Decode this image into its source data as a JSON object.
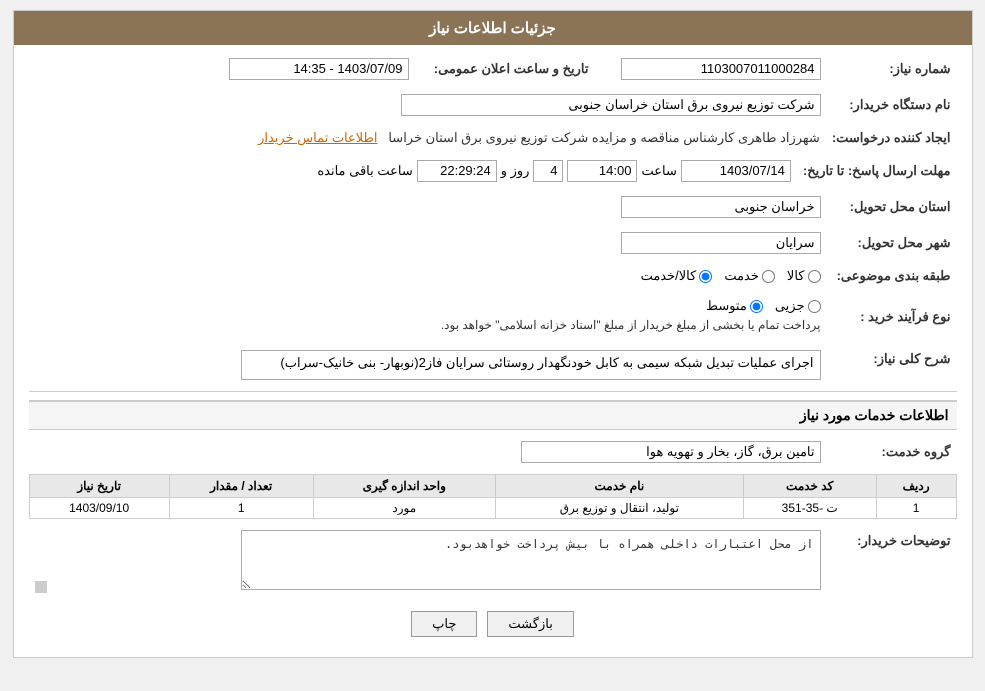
{
  "header": {
    "title": "جزئیات اطلاعات نیاز"
  },
  "fields": {
    "need_number_label": "شماره نیاز:",
    "need_number_value": "1103007011000284",
    "buyer_org_label": "نام دستگاه خریدار:",
    "buyer_org_value": "شرکت توزیع نیروی برق استان خراسان جنوبی",
    "creator_label": "ایجاد کننده درخواست:",
    "creator_value": "شهرزاد طاهری کارشناس مناقصه و مزایده شرکت توزیع نیروی برق استان خراسا",
    "creator_link": "اطلاعات تماس خریدار",
    "announce_date_label": "تاریخ و ساعت اعلان عمومی:",
    "announce_date_value": "1403/07/09 - 14:35",
    "response_deadline_label": "مهلت ارسال پاسخ: تا تاریخ:",
    "response_date": "1403/07/14",
    "response_time": "14:00",
    "response_days": "4",
    "response_remaining": "22:29:24",
    "remaining_label": "روز و",
    "remaining_suffix": "ساعت باقی مانده",
    "delivery_province_label": "استان محل تحویل:",
    "delivery_province_value": "خراسان جنوبی",
    "delivery_city_label": "شهر محل تحویل:",
    "delivery_city_value": "سرایان",
    "category_label": "طبقه بندی موضوعی:",
    "category_options": [
      "کالا",
      "خدمت",
      "کالا/خدمت"
    ],
    "category_selected": "کالا/خدمت",
    "purchase_type_label": "نوع فرآیند خرید :",
    "purchase_options": [
      "جزیی",
      "متوسط"
    ],
    "purchase_note": "پرداخت تمام یا بخشی از مبلغ خریدار از مبلغ \"اسناد خزانه اسلامی\" خواهد بود.",
    "need_description_label": "شرح کلی نیاز:",
    "need_description_value": "اجرای عملیات تبدیل شبکه سیمی به کابل خودنگهدار روستائی سرایان فاز2(نوبهار- بنی خانیک-سراب)",
    "services_section_title": "اطلاعات خدمات مورد نیاز",
    "service_group_label": "گروه خدمت:",
    "service_group_value": "تامین برق، گاز، بخار و تهویه هوا",
    "table": {
      "headers": [
        "ردیف",
        "کد خدمت",
        "نام خدمت",
        "واحد اندازه گیری",
        "تعداد / مقدار",
        "تاریخ نیاز"
      ],
      "rows": [
        {
          "row": "1",
          "service_code": "ت -35-351",
          "service_name": "تولید، انتقال و توزیع برق",
          "unit": "مورد",
          "quantity": "1",
          "date": "1403/09/10"
        }
      ]
    },
    "buyer_notes_label": "توضیحات خریدار:",
    "buyer_notes_value": "از محل اعتبارات داخلی همراه با بیش پرداخت خواهدبود.",
    "btn_print": "چاپ",
    "btn_back": "بازگشت"
  }
}
